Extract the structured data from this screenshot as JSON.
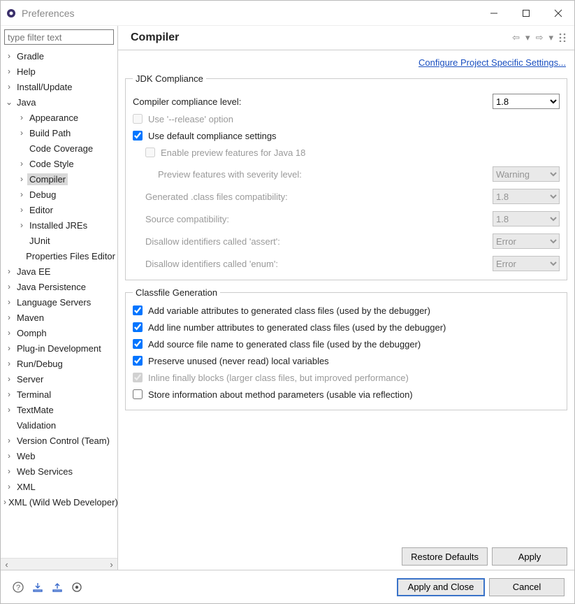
{
  "window": {
    "title": "Preferences"
  },
  "filter": {
    "placeholder": "type filter text"
  },
  "tree": [
    {
      "label": "Gradle",
      "depth": 0,
      "twisty": ">",
      "sel": false
    },
    {
      "label": "Help",
      "depth": 0,
      "twisty": ">",
      "sel": false
    },
    {
      "label": "Install/Update",
      "depth": 0,
      "twisty": ">",
      "sel": false
    },
    {
      "label": "Java",
      "depth": 0,
      "twisty": "v",
      "sel": false
    },
    {
      "label": "Appearance",
      "depth": 1,
      "twisty": ">",
      "sel": false
    },
    {
      "label": "Build Path",
      "depth": 1,
      "twisty": ">",
      "sel": false
    },
    {
      "label": "Code Coverage",
      "depth": 1,
      "twisty": "",
      "sel": false
    },
    {
      "label": "Code Style",
      "depth": 1,
      "twisty": ">",
      "sel": false
    },
    {
      "label": "Compiler",
      "depth": 1,
      "twisty": ">",
      "sel": true
    },
    {
      "label": "Debug",
      "depth": 1,
      "twisty": ">",
      "sel": false
    },
    {
      "label": "Editor",
      "depth": 1,
      "twisty": ">",
      "sel": false
    },
    {
      "label": "Installed JREs",
      "depth": 1,
      "twisty": ">",
      "sel": false
    },
    {
      "label": "JUnit",
      "depth": 1,
      "twisty": "",
      "sel": false
    },
    {
      "label": "Properties Files Editor",
      "depth": 1,
      "twisty": "",
      "sel": false
    },
    {
      "label": "Java EE",
      "depth": 0,
      "twisty": ">",
      "sel": false
    },
    {
      "label": "Java Persistence",
      "depth": 0,
      "twisty": ">",
      "sel": false
    },
    {
      "label": "Language Servers",
      "depth": 0,
      "twisty": ">",
      "sel": false
    },
    {
      "label": "Maven",
      "depth": 0,
      "twisty": ">",
      "sel": false
    },
    {
      "label": "Oomph",
      "depth": 0,
      "twisty": ">",
      "sel": false
    },
    {
      "label": "Plug-in Development",
      "depth": 0,
      "twisty": ">",
      "sel": false
    },
    {
      "label": "Run/Debug",
      "depth": 0,
      "twisty": ">",
      "sel": false
    },
    {
      "label": "Server",
      "depth": 0,
      "twisty": ">",
      "sel": false
    },
    {
      "label": "Terminal",
      "depth": 0,
      "twisty": ">",
      "sel": false
    },
    {
      "label": "TextMate",
      "depth": 0,
      "twisty": ">",
      "sel": false
    },
    {
      "label": "Validation",
      "depth": 0,
      "twisty": "",
      "sel": false
    },
    {
      "label": "Version Control (Team)",
      "depth": 0,
      "twisty": ">",
      "sel": false
    },
    {
      "label": "Web",
      "depth": 0,
      "twisty": ">",
      "sel": false
    },
    {
      "label": "Web Services",
      "depth": 0,
      "twisty": ">",
      "sel": false
    },
    {
      "label": "XML",
      "depth": 0,
      "twisty": ">",
      "sel": false
    },
    {
      "label": "XML (Wild Web Developer)",
      "depth": 0,
      "twisty": ">",
      "sel": false
    }
  ],
  "page": {
    "title": "Compiler",
    "config_link": "Configure Project Specific Settings...",
    "jdk": {
      "legend": "JDK Compliance",
      "compliance_label": "Compiler compliance level:",
      "compliance_value": "1.8",
      "use_release_label": "Use '--release' option",
      "use_release_checked": false,
      "use_release_disabled": true,
      "use_default_label": "Use default compliance settings",
      "use_default_checked": true,
      "enable_preview_label": "Enable preview features for Java 18",
      "enable_preview_checked": false,
      "enable_preview_disabled": true,
      "preview_severity_label": "Preview features with severity level:",
      "preview_severity_value": "Warning",
      "generated_label": "Generated .class files compatibility:",
      "generated_value": "1.8",
      "source_label": "Source compatibility:",
      "source_value": "1.8",
      "assert_label": "Disallow identifiers called 'assert':",
      "assert_value": "Error",
      "enum_label": "Disallow identifiers called 'enum':",
      "enum_value": "Error"
    },
    "classfile": {
      "legend": "Classfile Generation",
      "items": [
        {
          "label": "Add variable attributes to generated class files (used by the debugger)",
          "checked": true,
          "disabled": false
        },
        {
          "label": "Add line number attributes to generated class files (used by the debugger)",
          "checked": true,
          "disabled": false
        },
        {
          "label": "Add source file name to generated class file (used by the debugger)",
          "checked": true,
          "disabled": false
        },
        {
          "label": "Preserve unused (never read) local variables",
          "checked": true,
          "disabled": false
        },
        {
          "label": "Inline finally blocks (larger class files, but improved performance)",
          "checked": true,
          "disabled": true
        },
        {
          "label": "Store information about method parameters (usable via reflection)",
          "checked": false,
          "disabled": false
        }
      ]
    },
    "buttons": {
      "restore": "Restore Defaults",
      "apply": "Apply",
      "apply_close": "Apply and Close",
      "cancel": "Cancel"
    }
  }
}
